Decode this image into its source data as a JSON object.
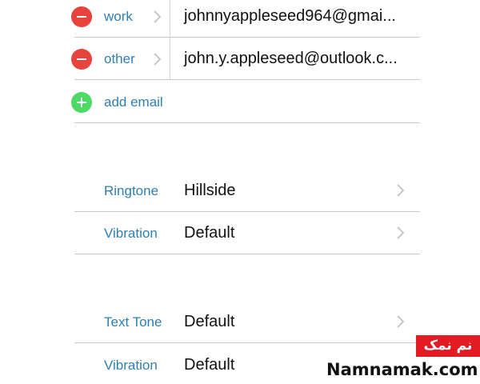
{
  "email": {
    "rows": [
      {
        "label": "work",
        "value": "johnnyappleseed964@gmai..."
      },
      {
        "label": "other",
        "value": "john.y.appleseed@outlook.c..."
      }
    ],
    "add_label": "add email"
  },
  "ringtone_section": {
    "rows": [
      {
        "label": "Ringtone",
        "value": "Hillside"
      },
      {
        "label": "Vibration",
        "value": "Default"
      }
    ]
  },
  "texttone_section": {
    "rows": [
      {
        "label": "Text Tone",
        "value": "Default"
      },
      {
        "label": "Vibration",
        "value": "Default"
      }
    ]
  },
  "watermark": {
    "persian": "نم نمک",
    "site": "Namnamak.com"
  },
  "colors": {
    "label_blue": "#2f7fb0",
    "delete_red": "#e8423d",
    "add_green": "#4cd964",
    "separator": "#c8c7cc",
    "watermark_red": "#e31b23"
  }
}
